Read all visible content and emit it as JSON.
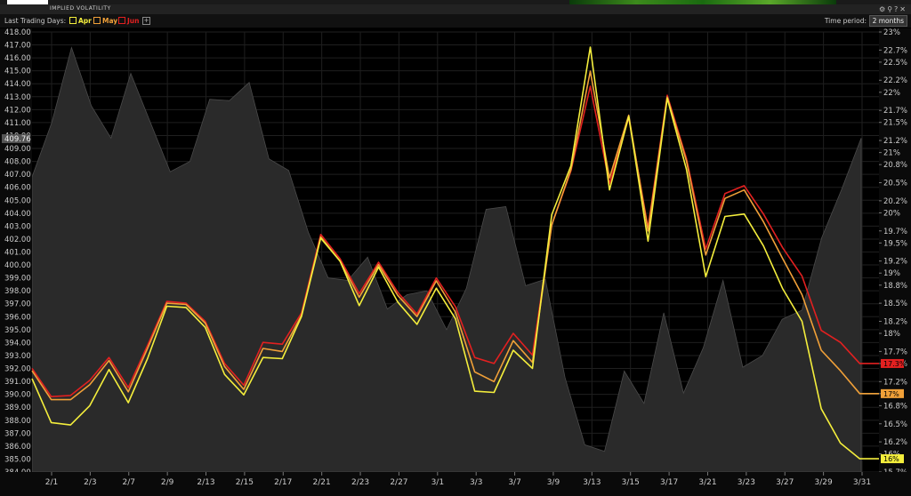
{
  "window": {
    "title": "IMPLIED VOLATILITY"
  },
  "controls": {
    "last_trading_days_label": "Last Trading Days:",
    "checkboxes": [
      {
        "label": "Apr",
        "checked": true,
        "color": "#f4ee3c"
      },
      {
        "label": "May",
        "checked": true,
        "color": "#f0a038"
      },
      {
        "label": "Jun",
        "checked": true,
        "color": "#e22020"
      }
    ],
    "add_label": "+",
    "time_period_label": "Time period:",
    "time_period_value": "2 months"
  },
  "chart_data": {
    "type": "line",
    "left_axis": {
      "ticks": [
        "384.00",
        "385.00",
        "386.00",
        "387.00",
        "388.00",
        "389.00",
        "390.00",
        "391.00",
        "392.00",
        "393.00",
        "394.00",
        "395.00",
        "396.00",
        "397.00",
        "398.00",
        "399.00",
        "400.00",
        "401.00",
        "402.00",
        "403.00",
        "404.00",
        "405.00",
        "406.00",
        "407.00",
        "408.00",
        "409.00",
        "410.00",
        "411.00",
        "412.00",
        "413.00",
        "414.00",
        "415.00",
        "416.00",
        "417.00",
        "418.00"
      ],
      "min": 384,
      "max": 418,
      "current_value_label": "409.76"
    },
    "right_axis": {
      "ticks": [
        "15.7%",
        "16%",
        "16.2%",
        "16.5%",
        "16.8%",
        "17%",
        "17.2%",
        "17.5%",
        "17.7%",
        "18%",
        "18.2%",
        "18.5%",
        "18.8%",
        "19%",
        "19.2%",
        "19.5%",
        "19.7%",
        "20%",
        "20.2%",
        "20.5%",
        "20.8%",
        "21%",
        "21.2%",
        "21.5%",
        "21.7%",
        "22%",
        "22.2%",
        "22.5%",
        "22.7%",
        "23%"
      ],
      "min": 15.7,
      "max": 23.0
    },
    "x_tick_labels": [
      "2/1",
      "2/3",
      "2/7",
      "2/9",
      "2/13",
      "2/15",
      "2/17",
      "2/21",
      "2/23",
      "2/27",
      "3/1",
      "3/3",
      "3/7",
      "3/9",
      "3/13",
      "3/15",
      "3/17",
      "3/21",
      "3/23",
      "3/27",
      "3/29",
      "3/31"
    ],
    "grid": true,
    "price_series": {
      "color": "#2a2a2a",
      "values": [
        406.8,
        411.0,
        416.8,
        412.3,
        409.8,
        414.8,
        411.0,
        407.2,
        408.0,
        412.8,
        412.7,
        414.1,
        408.2,
        407.3,
        402.5,
        399.0,
        398.8,
        400.6,
        396.6,
        397.7,
        398.0,
        395.0,
        398.2,
        404.3,
        404.5,
        398.4,
        398.9,
        391.3,
        386.1,
        385.6,
        391.8,
        389.3,
        396.3,
        390.1,
        393.6,
        398.8,
        392.1,
        393.0,
        395.8,
        396.5,
        402.1,
        405.8,
        409.8
      ]
    },
    "series": [
      {
        "name": "Apr",
        "color": "#f4ee3c",
        "end_label": "16%",
        "values": [
          17.25,
          16.52,
          16.48,
          16.8,
          17.4,
          16.85,
          17.58,
          18.45,
          18.43,
          18.1,
          17.32,
          16.98,
          17.6,
          17.58,
          18.28,
          19.58,
          19.2,
          18.46,
          19.1,
          18.52,
          18.15,
          18.75,
          18.24,
          17.04,
          17.02,
          17.72,
          17.42,
          19.97,
          20.78,
          22.75,
          20.38,
          21.6,
          19.53,
          21.9,
          20.72,
          18.94,
          19.94,
          19.98,
          19.45,
          18.74,
          18.2,
          16.75,
          16.18,
          15.92,
          15.92
        ]
      },
      {
        "name": "May",
        "color": "#f0a038",
        "end_label": "17%",
        "values": [
          17.38,
          16.9,
          16.9,
          17.15,
          17.55,
          17.03,
          17.75,
          18.5,
          18.48,
          18.17,
          17.45,
          17.07,
          17.75,
          17.7,
          18.3,
          19.6,
          19.2,
          18.6,
          19.14,
          18.63,
          18.28,
          18.87,
          18.35,
          17.36,
          17.2,
          17.88,
          17.52,
          19.8,
          20.72,
          22.35,
          20.58,
          21.62,
          19.7,
          21.92,
          20.86,
          19.3,
          20.24,
          20.38,
          19.85,
          19.24,
          18.64,
          17.72,
          17.38,
          17.0,
          17.0
        ]
      },
      {
        "name": "Jun",
        "color": "#e22020",
        "end_label": "17.3%",
        "values": [
          17.42,
          16.95,
          16.97,
          17.22,
          17.6,
          17.1,
          17.8,
          18.53,
          18.5,
          18.2,
          17.5,
          17.14,
          17.85,
          17.82,
          18.34,
          19.64,
          19.24,
          18.66,
          19.18,
          18.68,
          18.32,
          18.92,
          18.44,
          17.6,
          17.5,
          18.0,
          17.64,
          19.8,
          20.7,
          22.1,
          20.48,
          21.58,
          19.75,
          21.95,
          20.9,
          19.4,
          20.32,
          20.45,
          19.98,
          19.42,
          18.95,
          18.05,
          17.85,
          17.5,
          17.5
        ]
      }
    ]
  }
}
